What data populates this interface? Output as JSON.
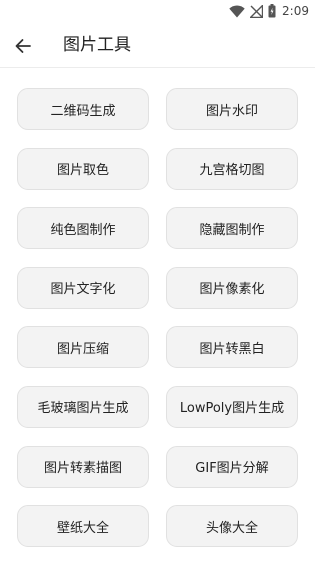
{
  "status_bar": {
    "time": "2:09",
    "icons": [
      "wifi-icon",
      "signal-off-icon",
      "battery-icon"
    ]
  },
  "header": {
    "back_icon": "arrow-left-icon",
    "title": "图片工具"
  },
  "tools": [
    {
      "label": "二维码生成"
    },
    {
      "label": "图片水印"
    },
    {
      "label": "图片取色"
    },
    {
      "label": "九宫格切图"
    },
    {
      "label": "纯色图制作"
    },
    {
      "label": "隐藏图制作"
    },
    {
      "label": "图片文字化"
    },
    {
      "label": "图片像素化"
    },
    {
      "label": "图片压缩"
    },
    {
      "label": "图片转黑白"
    },
    {
      "label": "毛玻璃图片生成"
    },
    {
      "label": "LowPoly图片生成"
    },
    {
      "label": "图片转素描图"
    },
    {
      "label": "GIF图片分解"
    },
    {
      "label": "壁纸大全"
    },
    {
      "label": "头像大全"
    }
  ],
  "colors": {
    "background": "#ffffff",
    "button_fill": "#f3f3f3",
    "button_border": "#e1e1e1",
    "text": "#222222"
  }
}
